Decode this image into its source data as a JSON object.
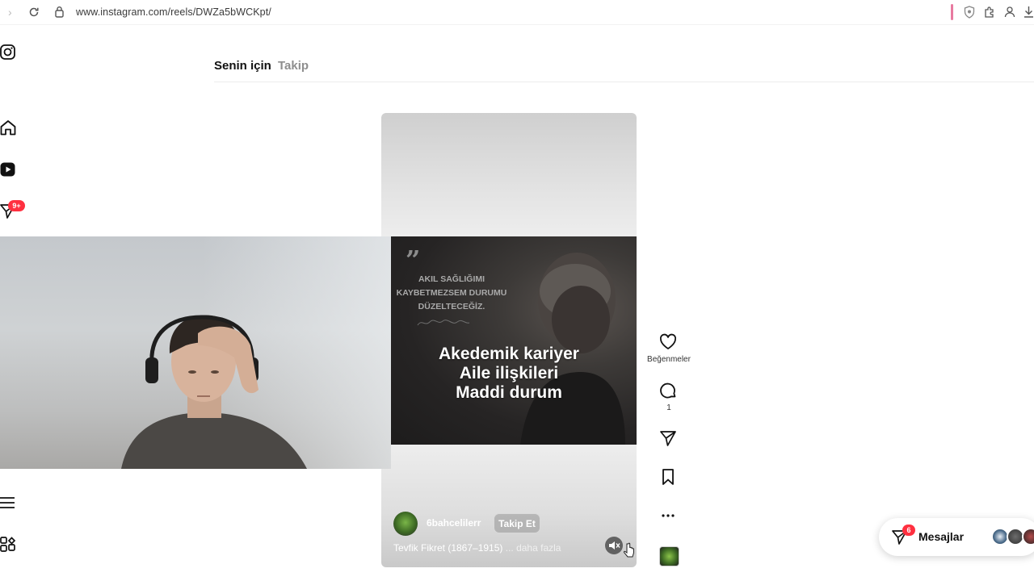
{
  "browser": {
    "url": "www.instagram.com/reels/DWZa5bWCKpt/"
  },
  "tabs": [
    {
      "label": "Senin için",
      "active": true
    },
    {
      "label": "Takip",
      "active": false
    }
  ],
  "sidebar": {
    "notification_badge": "9+"
  },
  "reel": {
    "quote_lines": [
      "AKIL SAĞLIĞIMI",
      "KAYBETMEZSEM DURUMU",
      "DÜZELTECEĞİZ."
    ],
    "caption_lines": [
      "Akedemik kariyer",
      "Aile ilişkileri",
      "Maddi durum"
    ],
    "author": "6bahcelilerr",
    "follow_label": "Takip Et",
    "description": "Tevfik Fikret (1867–1915)",
    "more_label": "... daha fazla"
  },
  "actions": {
    "likes_label": "Beğenmeler",
    "comments_count": "1"
  },
  "messages": {
    "label": "Mesajlar",
    "badge": "6"
  },
  "colors": {
    "badge_red": "#ff3040",
    "muted_tab": "#8e8e8e"
  }
}
